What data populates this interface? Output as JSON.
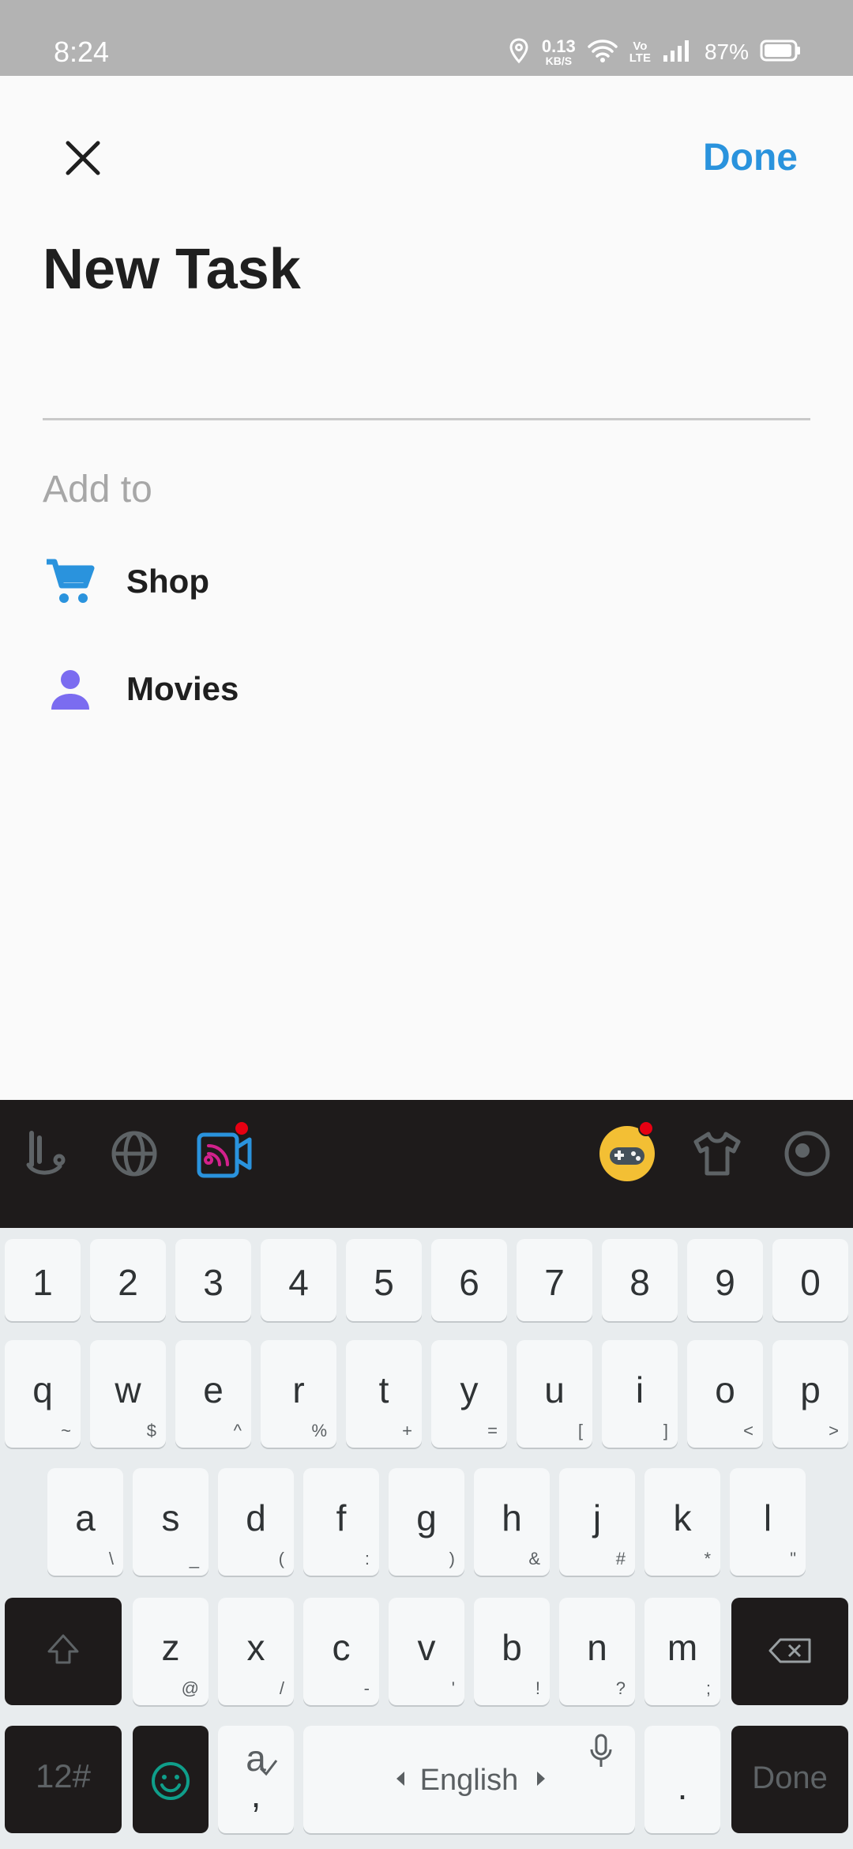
{
  "status_bar": {
    "time": "8:24",
    "speed_value": "0.13",
    "speed_unit": "KB/S",
    "volte_top": "Vo",
    "volte_bottom": "LTE",
    "battery": "87%"
  },
  "header": {
    "close_icon": "close-icon",
    "done_label": "Done"
  },
  "title": "New Task",
  "task_input": {
    "value": "",
    "placeholder": ""
  },
  "add_to": {
    "label": "Add to",
    "lists": [
      {
        "name": "Shop",
        "icon": "cart-icon",
        "color": "#2a93dd"
      },
      {
        "name": "Movies",
        "icon": "person-icon",
        "color": "#7b6cf0"
      }
    ]
  },
  "keyboard": {
    "toolbar_icons": [
      "touchpal-icon",
      "globe-icon",
      "video-icon",
      "game-icon",
      "theme-shirt-icon",
      "sticker-icon"
    ],
    "number_row": [
      "1",
      "2",
      "3",
      "4",
      "5",
      "6",
      "7",
      "8",
      "9",
      "0"
    ],
    "row1": [
      {
        "key": "q",
        "alt": "~"
      },
      {
        "key": "w",
        "alt": "$"
      },
      {
        "key": "e",
        "alt": "^"
      },
      {
        "key": "r",
        "alt": "%"
      },
      {
        "key": "t",
        "alt": "+"
      },
      {
        "key": "y",
        "alt": "="
      },
      {
        "key": "u",
        "alt": "["
      },
      {
        "key": "i",
        "alt": "]"
      },
      {
        "key": "o",
        "alt": "<"
      },
      {
        "key": "p",
        "alt": ">"
      }
    ],
    "row2": [
      {
        "key": "a",
        "alt": "\\"
      },
      {
        "key": "s",
        "alt": "_"
      },
      {
        "key": "d",
        "alt": "("
      },
      {
        "key": "f",
        "alt": ":"
      },
      {
        "key": "g",
        "alt": ")"
      },
      {
        "key": "h",
        "alt": "&"
      },
      {
        "key": "j",
        "alt": "#"
      },
      {
        "key": "k",
        "alt": "*"
      },
      {
        "key": "l",
        "alt": "\""
      }
    ],
    "row3": [
      {
        "key": "z",
        "alt": "@"
      },
      {
        "key": "x",
        "alt": "/"
      },
      {
        "key": "c",
        "alt": "-"
      },
      {
        "key": "v",
        "alt": "'"
      },
      {
        "key": "b",
        "alt": "!"
      },
      {
        "key": "n",
        "alt": "?"
      },
      {
        "key": "m",
        "alt": ";"
      }
    ],
    "symbols_label": "12#",
    "comma_top": "a",
    "comma_bottom": ",",
    "space_label": "English",
    "period_label": ".",
    "done_label": "Done"
  },
  "colors": {
    "accent": "#2a93dd",
    "status_bar": "#b3b3b3",
    "keyboard_toolbar": "#1e1b1b",
    "keyboard_bg": "#e8ecee",
    "badge": "#e70012"
  }
}
